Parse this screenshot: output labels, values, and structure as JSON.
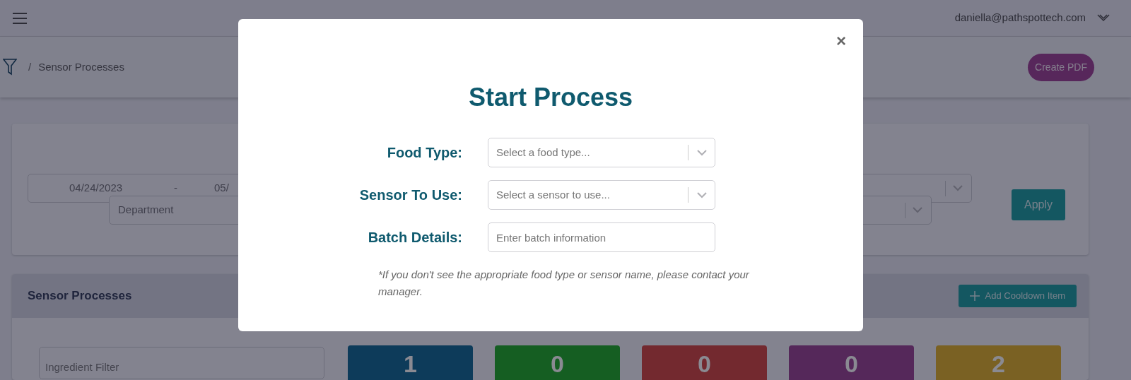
{
  "topbar": {
    "user_email": "daniella@pathspottech.com"
  },
  "breadcrumb": {
    "separator": "/",
    "current": "Sensor Processes"
  },
  "create_pdf_button": "Create PDF",
  "filters": {
    "date_start": "04/24/2023",
    "date_separator": "-",
    "date_end": "05/",
    "department_placeholder": "Department",
    "apply_button": "Apply"
  },
  "sensor_processes": {
    "title": "Sensor Processes",
    "add_button": "Add Cooldown Item",
    "ingredient_filter_placeholder": "Ingredient Filter",
    "tiles": [
      {
        "count": "1",
        "color": "#0d3b5a"
      },
      {
        "count": "0",
        "color": "#155e22"
      },
      {
        "count": "0",
        "color": "#73292f"
      },
      {
        "count": "0",
        "color": "#55285a"
      },
      {
        "count": "2",
        "color": "#7a6123"
      }
    ]
  },
  "modal": {
    "title": "Start Process",
    "close": "×",
    "fields": [
      {
        "kind": "select",
        "label": "Food Type:",
        "placeholder": "Select a food type..."
      },
      {
        "kind": "select",
        "label": "Sensor To Use:",
        "placeholder": "Select a sensor to use..."
      },
      {
        "kind": "text",
        "label": "Batch Details:",
        "placeholder": "Enter batch information"
      }
    ],
    "note": "*If you don't see the appropriate food type or sensor name, please contact your manager."
  }
}
